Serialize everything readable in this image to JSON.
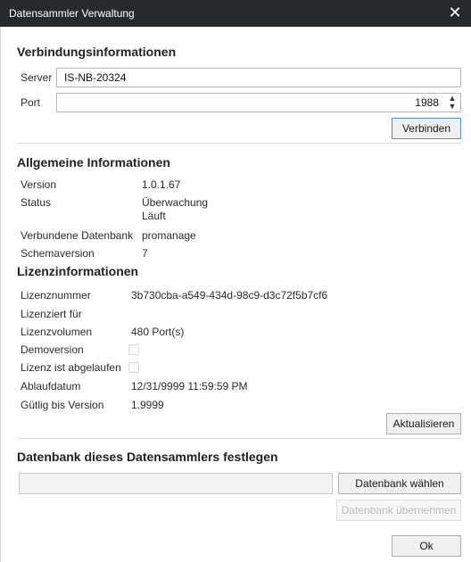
{
  "window": {
    "title": "Datensammler Verwaltung"
  },
  "connection": {
    "section_title": "Verbindungsinformationen",
    "server_label": "Server",
    "server_value": "IS-NB-20324",
    "port_label": "Port",
    "port_value": "1988",
    "connect_label": "Verbinden"
  },
  "general": {
    "section_title": "Allgemeine Informationen",
    "version_label": "Version",
    "version_value": "1.0.1.67",
    "status_label": "Status",
    "status_value_line1": "Überwachung",
    "status_value_line2": "Läuft",
    "db_label": "Verbundene Datenbank",
    "db_value": "promanage",
    "schema_label": "Schemaversion",
    "schema_value": "7"
  },
  "license": {
    "section_title": "Lizenzinformationen",
    "number_label": "Lizenznummer",
    "number_value": "3b730cba-a549-434d-98c9-d3c72f5b7cf6",
    "licensed_for_label": "Lizenziert für",
    "licensed_for_value": "",
    "volume_label": "Lizenzvolumen",
    "volume_value": "480 Port(s)",
    "demo_label": "Demoversion",
    "demo_checked": false,
    "expired_label": "Lizenz ist abgelaufen",
    "expired_checked": false,
    "expiry_label": "Ablaufdatum",
    "expiry_value": "12/31/9999 11:59:59 PM",
    "valid_until_label": "Gütlig bis Version",
    "valid_until_value": "1.9999",
    "refresh_label": "Aktualisieren"
  },
  "database": {
    "section_title": "Datenbank dieses Datensammlers festlegen",
    "db_path_value": "",
    "choose_label": "Datenbank wählen",
    "apply_label": "Datenbank übernehmen"
  },
  "footer": {
    "ok_label": "Ok"
  }
}
